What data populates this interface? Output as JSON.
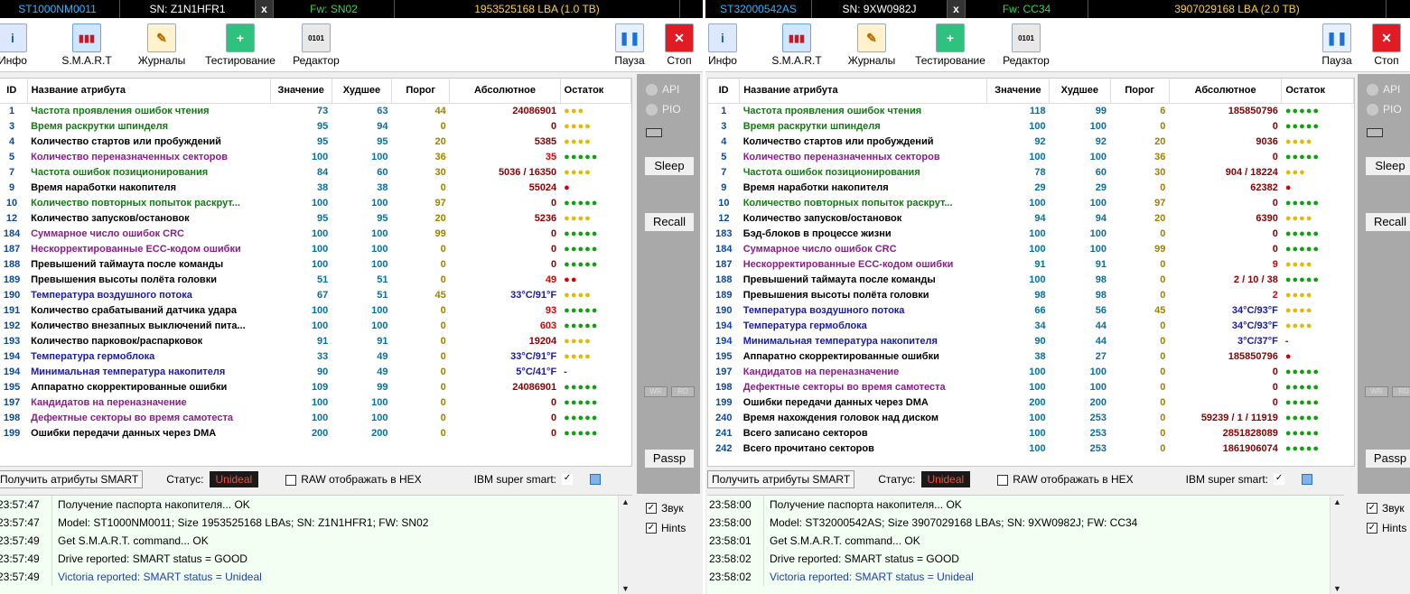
{
  "left": {
    "header": {
      "model": "ST1000NM0011",
      "sn": "SN: Z1N1HFR1",
      "close": "x",
      "fw": "Fw: SN02",
      "lba": "1953525168 LBA (1.0 TB)"
    },
    "toolbar": {
      "info": "Инфо",
      "smart": "S.M.A.R.T",
      "logs": "Журналы",
      "test": "Тестирование",
      "editor": "Редактор",
      "pause": "Пауза",
      "stop": "Стоп"
    },
    "columns": {
      "id": "ID",
      "name": "Название атрибута",
      "value": "Значение",
      "worst": "Худшее",
      "threshold": "Порог",
      "raw": "Абсолютное",
      "remaining": "Остаток"
    },
    "rows": [
      {
        "id": "1",
        "name": "Частота проявления ошибок чтения",
        "value": "73",
        "worst": "63",
        "thr": "44",
        "raw": "24086901",
        "rem": "●●●",
        "nc": "n-green",
        "dc": "d-yellow",
        "rc": ""
      },
      {
        "id": "3",
        "name": "Время раскрутки шпинделя",
        "value": "95",
        "worst": "94",
        "thr": "0",
        "raw": "0",
        "rem": "●●●●",
        "nc": "n-green",
        "dc": "d-yellow",
        "rc": ""
      },
      {
        "id": "4",
        "name": "Количество стартов или пробуждений",
        "value": "95",
        "worst": "95",
        "thr": "20",
        "raw": "5385",
        "rem": "●●●●",
        "nc": "n-black",
        "dc": "d-yellow",
        "rc": ""
      },
      {
        "id": "5",
        "name": "Количество переназначенных секторов",
        "value": "100",
        "worst": "100",
        "thr": "36",
        "raw": "35",
        "rem": "●●●●●",
        "nc": "n-purple",
        "dc": "d-green",
        "rc": "raw-red"
      },
      {
        "id": "7",
        "name": "Частота ошибок позиционирования",
        "value": "84",
        "worst": "60",
        "thr": "30",
        "raw": "5036 / 16350",
        "rem": "●●●●",
        "nc": "n-green",
        "dc": "d-yellow",
        "rc": ""
      },
      {
        "id": "9",
        "name": "Время наработки накопителя",
        "value": "38",
        "worst": "38",
        "thr": "0",
        "raw": "55024",
        "rem": "●",
        "nc": "n-black",
        "dc": "d-red",
        "rc": ""
      },
      {
        "id": "10",
        "name": "Количество повторных попыток раскрут...",
        "value": "100",
        "worst": "100",
        "thr": "97",
        "raw": "0",
        "rem": "●●●●●",
        "nc": "n-green",
        "dc": "d-green",
        "rc": ""
      },
      {
        "id": "12",
        "name": "Количество запусков/остановок",
        "value": "95",
        "worst": "95",
        "thr": "20",
        "raw": "5236",
        "rem": "●●●●",
        "nc": "n-black",
        "dc": "d-yellow",
        "rc": ""
      },
      {
        "id": "184",
        "name": "Суммарное число ошибок CRC",
        "value": "100",
        "worst": "100",
        "thr": "99",
        "raw": "0",
        "rem": "●●●●●",
        "nc": "n-purple",
        "dc": "d-green",
        "rc": "raw-zero"
      },
      {
        "id": "187",
        "name": "Нескорректированные ECC-кодом ошибки",
        "value": "100",
        "worst": "100",
        "thr": "0",
        "raw": "0",
        "rem": "●●●●●",
        "nc": "n-purple",
        "dc": "d-green",
        "rc": "raw-zero"
      },
      {
        "id": "188",
        "name": "Превышений таймаута после команды",
        "value": "100",
        "worst": "100",
        "thr": "0",
        "raw": "0",
        "rem": "●●●●●",
        "nc": "n-black",
        "dc": "d-green",
        "rc": ""
      },
      {
        "id": "189",
        "name": "Превышения высоты полёта головки",
        "value": "51",
        "worst": "51",
        "thr": "0",
        "raw": "49",
        "rem": "●●",
        "nc": "n-black",
        "dc": "d-red",
        "rc": "raw-red"
      },
      {
        "id": "190",
        "name": "Температура воздушного потока",
        "value": "67",
        "worst": "51",
        "thr": "45",
        "raw": "33°C/91°F",
        "rem": "●●●●",
        "nc": "n-blue",
        "dc": "d-yellow",
        "rc": "raw-blue"
      },
      {
        "id": "191",
        "name": "Количество срабатываний датчика удара",
        "value": "100",
        "worst": "100",
        "thr": "0",
        "raw": "93",
        "rem": "●●●●●",
        "nc": "n-black",
        "dc": "d-green",
        "rc": "raw-red"
      },
      {
        "id": "192",
        "name": "Количество внезапных выключений пита...",
        "value": "100",
        "worst": "100",
        "thr": "0",
        "raw": "603",
        "rem": "●●●●●",
        "nc": "n-black",
        "dc": "d-green",
        "rc": "raw-red"
      },
      {
        "id": "193",
        "name": "Количество парковок/распарковок",
        "value": "91",
        "worst": "91",
        "thr": "0",
        "raw": "19204",
        "rem": "●●●●",
        "nc": "n-black",
        "dc": "d-yellow",
        "rc": ""
      },
      {
        "id": "194",
        "name": "Температура гермоблока",
        "value": "33",
        "worst": "49",
        "thr": "0",
        "raw": "33°C/91°F",
        "rem": "●●●●",
        "nc": "n-blue",
        "dc": "d-yellow",
        "rc": "raw-blue"
      },
      {
        "id": "194",
        "name": "Минимальная температура накопителя",
        "value": "90",
        "worst": "49",
        "thr": "0",
        "raw": "5°C/41°F",
        "rem": "-",
        "nc": "n-blue",
        "dc": "d-dash",
        "rc": "raw-blue"
      },
      {
        "id": "195",
        "name": "Аппаратно скорректированные ошибки",
        "value": "109",
        "worst": "99",
        "thr": "0",
        "raw": "24086901",
        "rem": "●●●●●",
        "nc": "n-black",
        "dc": "d-green",
        "rc": ""
      },
      {
        "id": "197",
        "name": "Кандидатов на переназначение",
        "value": "100",
        "worst": "100",
        "thr": "0",
        "raw": "0",
        "rem": "●●●●●",
        "nc": "n-purple",
        "dc": "d-green",
        "rc": "raw-zero"
      },
      {
        "id": "198",
        "name": "Дефектные секторы во время самотеста",
        "value": "100",
        "worst": "100",
        "thr": "0",
        "raw": "0",
        "rem": "●●●●●",
        "nc": "n-purple",
        "dc": "d-green",
        "rc": "raw-zero"
      },
      {
        "id": "199",
        "name": "Ошибки передачи данных через DMA",
        "value": "200",
        "worst": "200",
        "thr": "0",
        "raw": "0",
        "rem": "●●●●●",
        "nc": "n-black",
        "dc": "d-green",
        "rc": ""
      }
    ],
    "side": {
      "api": "API",
      "pio": "PIO",
      "sleep": "Sleep",
      "recall": "Recall",
      "wr": "WR",
      "rd": "RD",
      "passp": "Passp",
      "sound": "Звук",
      "hints": "Hints"
    },
    "status": {
      "get_smart": "Получить атрибуты SMART",
      "status_label": "Статус:",
      "status_value": "Unideal",
      "raw_hex": "RAW отображать в HEX",
      "ibm": "IBM super smart:",
      "ibm_check": "✓"
    },
    "log": [
      {
        "t": "23:57:47",
        "m": "Получение паспорта накопителя... OK",
        "blue": false
      },
      {
        "t": "23:57:47",
        "m": "Model: ST1000NM0011; Size 1953525168 LBAs; SN: Z1N1HFR1; FW: SN02",
        "blue": false
      },
      {
        "t": "23:57:49",
        "m": "Get S.M.A.R.T. command... OK",
        "blue": false
      },
      {
        "t": "23:57:49",
        "m": "Drive reported: SMART status = GOOD",
        "blue": false
      },
      {
        "t": "23:57:49",
        "m": "Victoria reported: SMART status = Unideal",
        "blue": true
      }
    ]
  },
  "right": {
    "header": {
      "model": "ST32000542AS",
      "sn": "SN: 9XW0982J",
      "close": "x",
      "fw": "Fw: CC34",
      "lba": "3907029168 LBA (2.0 TB)"
    },
    "toolbar": {
      "info": "Инфо",
      "smart": "S.M.A.R.T",
      "logs": "Журналы",
      "test": "Тестирование",
      "editor": "Редактор",
      "pause": "Пауза",
      "stop": "Стоп"
    },
    "columns": {
      "id": "ID",
      "name": "Название атрибута",
      "value": "Значение",
      "worst": "Худшее",
      "threshold": "Порог",
      "raw": "Абсолютное",
      "remaining": "Остаток"
    },
    "rows": [
      {
        "id": "1",
        "name": "Частота проявления ошибок чтения",
        "value": "118",
        "worst": "99",
        "thr": "6",
        "raw": "185850796",
        "rem": "●●●●●",
        "nc": "n-green",
        "dc": "d-green",
        "rc": ""
      },
      {
        "id": "3",
        "name": "Время раскрутки шпинделя",
        "value": "100",
        "worst": "100",
        "thr": "0",
        "raw": "0",
        "rem": "●●●●●",
        "nc": "n-green",
        "dc": "d-green",
        "rc": ""
      },
      {
        "id": "4",
        "name": "Количество стартов или пробуждений",
        "value": "92",
        "worst": "92",
        "thr": "20",
        "raw": "9036",
        "rem": "●●●●",
        "nc": "n-black",
        "dc": "d-yellow",
        "rc": ""
      },
      {
        "id": "5",
        "name": "Количество переназначенных секторов",
        "value": "100",
        "worst": "100",
        "thr": "36",
        "raw": "0",
        "rem": "●●●●●",
        "nc": "n-purple",
        "dc": "d-green",
        "rc": "raw-zero"
      },
      {
        "id": "7",
        "name": "Частота ошибок позиционирования",
        "value": "78",
        "worst": "60",
        "thr": "30",
        "raw": "904 / 18224",
        "rem": "●●●",
        "nc": "n-green",
        "dc": "d-yellow",
        "rc": ""
      },
      {
        "id": "9",
        "name": "Время наработки накопителя",
        "value": "29",
        "worst": "29",
        "thr": "0",
        "raw": "62382",
        "rem": "●",
        "nc": "n-black",
        "dc": "d-red",
        "rc": ""
      },
      {
        "id": "10",
        "name": "Количество повторных попыток раскрут...",
        "value": "100",
        "worst": "100",
        "thr": "97",
        "raw": "0",
        "rem": "●●●●●",
        "nc": "n-green",
        "dc": "d-green",
        "rc": ""
      },
      {
        "id": "12",
        "name": "Количество запусков/остановок",
        "value": "94",
        "worst": "94",
        "thr": "20",
        "raw": "6390",
        "rem": "●●●●",
        "nc": "n-black",
        "dc": "d-yellow",
        "rc": ""
      },
      {
        "id": "183",
        "name": "Бэд-блоков в процессе жизни",
        "value": "100",
        "worst": "100",
        "thr": "0",
        "raw": "0",
        "rem": "●●●●●",
        "nc": "n-black",
        "dc": "d-green",
        "rc": ""
      },
      {
        "id": "184",
        "name": "Суммарное число ошибок CRC",
        "value": "100",
        "worst": "100",
        "thr": "99",
        "raw": "0",
        "rem": "●●●●●",
        "nc": "n-purple",
        "dc": "d-green",
        "rc": "raw-zero"
      },
      {
        "id": "187",
        "name": "Нескорректированные ECC-кодом ошибки",
        "value": "91",
        "worst": "91",
        "thr": "0",
        "raw": "9",
        "rem": "●●●●",
        "nc": "n-purple",
        "dc": "d-yellow",
        "rc": "raw-red"
      },
      {
        "id": "188",
        "name": "Превышений таймаута после команды",
        "value": "100",
        "worst": "98",
        "thr": "0",
        "raw": "2 / 10 / 38",
        "rem": "●●●●●",
        "nc": "n-black",
        "dc": "d-green",
        "rc": ""
      },
      {
        "id": "189",
        "name": "Превышения высоты полёта головки",
        "value": "98",
        "worst": "98",
        "thr": "0",
        "raw": "2",
        "rem": "●●●●",
        "nc": "n-black",
        "dc": "d-yellow",
        "rc": "raw-red"
      },
      {
        "id": "190",
        "name": "Температура воздушного потока",
        "value": "66",
        "worst": "56",
        "thr": "45",
        "raw": "34°C/93°F",
        "rem": "●●●●",
        "nc": "n-blue",
        "dc": "d-yellow",
        "rc": "raw-blue"
      },
      {
        "id": "194",
        "name": "Температура гермоблока",
        "value": "34",
        "worst": "44",
        "thr": "0",
        "raw": "34°C/93°F",
        "rem": "●●●●",
        "nc": "n-blue",
        "dc": "d-yellow",
        "rc": "raw-blue"
      },
      {
        "id": "194",
        "name": "Минимальная температура накопителя",
        "value": "90",
        "worst": "44",
        "thr": "0",
        "raw": "3°C/37°F",
        "rem": "-",
        "nc": "n-blue",
        "dc": "d-dash",
        "rc": "raw-blue"
      },
      {
        "id": "195",
        "name": "Аппаратно скорректированные ошибки",
        "value": "38",
        "worst": "27",
        "thr": "0",
        "raw": "185850796",
        "rem": "●",
        "nc": "n-black",
        "dc": "d-red",
        "rc": ""
      },
      {
        "id": "197",
        "name": "Кандидатов на переназначение",
        "value": "100",
        "worst": "100",
        "thr": "0",
        "raw": "0",
        "rem": "●●●●●",
        "nc": "n-purple",
        "dc": "d-green",
        "rc": "raw-zero"
      },
      {
        "id": "198",
        "name": "Дефектные секторы во время самотеста",
        "value": "100",
        "worst": "100",
        "thr": "0",
        "raw": "0",
        "rem": "●●●●●",
        "nc": "n-purple",
        "dc": "d-green",
        "rc": "raw-zero"
      },
      {
        "id": "199",
        "name": "Ошибки передачи данных через DMA",
        "value": "200",
        "worst": "200",
        "thr": "0",
        "raw": "0",
        "rem": "●●●●●",
        "nc": "n-black",
        "dc": "d-green",
        "rc": ""
      },
      {
        "id": "240",
        "name": "Время нахождения головок над диском",
        "value": "100",
        "worst": "253",
        "thr": "0",
        "raw": "59239 / 1 / 11919",
        "rem": "●●●●●",
        "nc": "n-black",
        "dc": "d-green",
        "rc": ""
      },
      {
        "id": "241",
        "name": "Всего записано секторов",
        "value": "100",
        "worst": "253",
        "thr": "0",
        "raw": "2851828089",
        "rem": "●●●●●",
        "nc": "n-black",
        "dc": "d-green",
        "rc": ""
      },
      {
        "id": "242",
        "name": "Всего прочитано секторов",
        "value": "100",
        "worst": "253",
        "thr": "0",
        "raw": "1861906074",
        "rem": "●●●●●",
        "nc": "n-black",
        "dc": "d-green",
        "rc": ""
      }
    ],
    "side": {
      "api": "API",
      "pio": "PIO",
      "sleep": "Sleep",
      "recall": "Recall",
      "wr": "WR",
      "rd": "RD",
      "passp": "Passp",
      "sound": "Звук",
      "hints": "Hints"
    },
    "status": {
      "get_smart": "Получить атрибуты SMART",
      "status_label": "Статус:",
      "status_value": "Unideal",
      "raw_hex": "RAW отображать в HEX",
      "ibm": "IBM super smart:",
      "ibm_check": "✓"
    },
    "log": [
      {
        "t": "23:58:00",
        "m": "Получение паспорта накопителя... OK",
        "blue": false
      },
      {
        "t": "23:58:00",
        "m": "Model: ST32000542AS; Size 3907029168 LBAs; SN: 9XW0982J; FW: CC34",
        "blue": false
      },
      {
        "t": "23:58:01",
        "m": "Get S.M.A.R.T. command... OK",
        "blue": false
      },
      {
        "t": "23:58:02",
        "m": "Drive reported: SMART status = GOOD",
        "blue": false
      },
      {
        "t": "23:58:02",
        "m": "Victoria reported: SMART status = Unideal",
        "blue": true
      }
    ]
  },
  "icons": {
    "info": "i",
    "smart": "▮▮▮",
    "logs": "✎",
    "test": "+",
    "editor": "0101",
    "pause": "❚❚",
    "stop": "✕",
    "scroll_up": "▲",
    "scroll_down": "▼"
  },
  "colors": {
    "header_bg": "#000000",
    "model": "#2bb7ff",
    "fw": "#32d74b",
    "lba": "#ffd21f",
    "status_bad": "#ff4a3a",
    "log_bg": "#f4fff4"
  }
}
